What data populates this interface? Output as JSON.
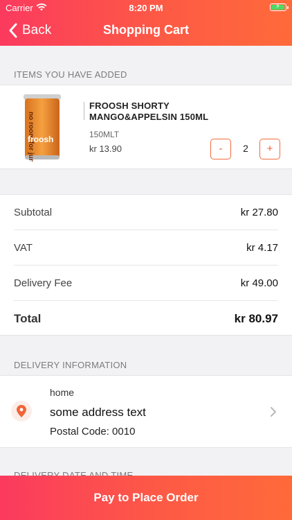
{
  "status_bar": {
    "carrier": "Carrier",
    "time": "8:20 PM"
  },
  "nav": {
    "back_label": "Back",
    "title": "Shopping Cart"
  },
  "items_section": {
    "label": "ITEMS YOU HAVE ADDED",
    "items": [
      {
        "name": "FROOSH SHORTY MANGO&APPELSIN 150ML",
        "size": "150MLT",
        "price": "kr 13.90",
        "quantity": "2",
        "minus_label": "-",
        "plus_label": "+",
        "image_text": "froosh"
      }
    ]
  },
  "summary": {
    "rows": [
      {
        "label": "Subtotal",
        "value": "kr 27.80"
      },
      {
        "label": "VAT",
        "value": "kr 4.17"
      },
      {
        "label": "Delivery Fee",
        "value": "kr 49.00"
      }
    ],
    "total": {
      "label": "Total",
      "value": "kr 80.97"
    }
  },
  "delivery": {
    "label": "DELIVERY INFORMATION",
    "address_name": "home",
    "address_text": "some address text",
    "postal": "Postal Code: 0010"
  },
  "next_section_label": "DELIVERY DATE AND TIME",
  "pay_button": {
    "label": "Pay to Place Order"
  },
  "colors": {
    "accent_start": "#fb3a5e",
    "accent_end": "#ff6a3a",
    "qty_border": "#f16a3b"
  },
  "icons": {
    "back": "chevron-left-icon",
    "location": "location-pin-icon",
    "disclosure": "chevron-right-icon"
  }
}
